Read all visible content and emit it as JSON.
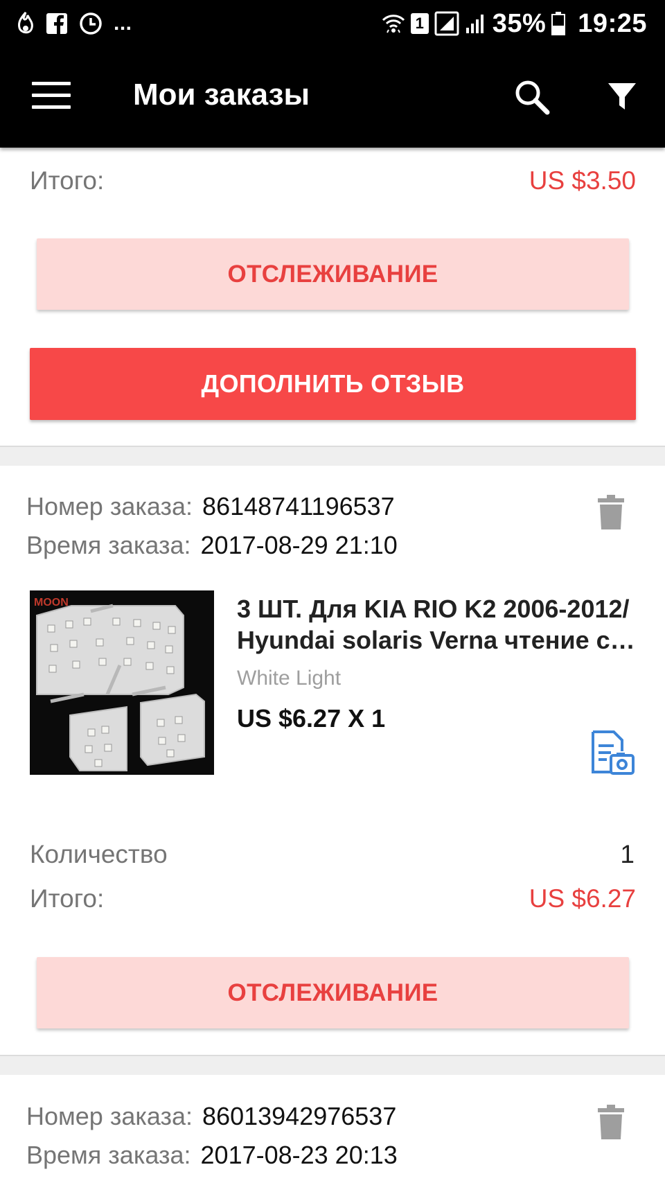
{
  "status_bar": {
    "battery": "35%",
    "time": "19:25",
    "sim": "1",
    "more": "..."
  },
  "header": {
    "title": "Мои заказы"
  },
  "order_prev": {
    "total_label": "Итого:",
    "total_value": "US $3.50",
    "track_label": "ОТСЛЕЖИВАНИЕ",
    "review_label": "ДОПОЛНИТЬ ОТЗЫВ"
  },
  "order1": {
    "number_label": "Номер заказа:",
    "number": "86148741196537",
    "time_label": "Время заказа:",
    "time": "2017-08-29 21:10",
    "product": {
      "title_line1": "3 ШТ. Для KIA RIO K2 2006-2012/",
      "title_line2": "Hyundai solaris Verna чтение св...",
      "variant": "White Light",
      "price": "US $6.27 X 1",
      "image_brand": "MOON"
    },
    "quantity_label": "Количество",
    "quantity_value": "1",
    "total_label": "Итого:",
    "total_value": "US $6.27",
    "track_label": "ОТСЛЕЖИВАНИЕ"
  },
  "order2": {
    "number_label": "Номер заказа:",
    "number": "86013942976537",
    "time_label": "Время заказа:",
    "time": "2017-08-23 20:13"
  },
  "colors": {
    "accent_red": "#f74848",
    "price_red": "#e8403f",
    "track_bg": "#fdd9d7",
    "toolbar": "#000000",
    "icon_blue": "#3d85d8"
  }
}
